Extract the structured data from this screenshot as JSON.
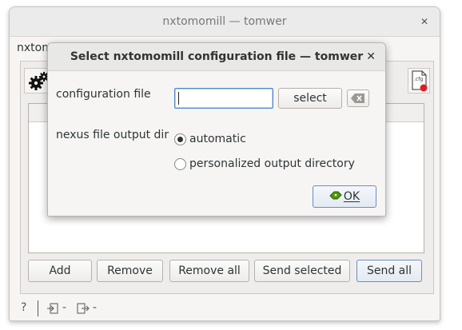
{
  "window": {
    "title": "nxtomomill — tomwer",
    "close_glyph": "✕",
    "main_label": "nxtom"
  },
  "toolbar": {
    "gear_icon": "gears-icon",
    "cfg_icon": "cfg-file-icon",
    "cfg_text": ".cfg"
  },
  "buttons": {
    "add": "Add",
    "remove": "Remove",
    "remove_all": "Remove all",
    "send_selected": "Send selected",
    "send_all": "Send all"
  },
  "statusbar": {
    "help": "?",
    "input_dash": "-",
    "output_dash": "-"
  },
  "dialog": {
    "title": "Select nxtomomill configuration file — tomwer",
    "close_glyph": "✕",
    "config_label": "configuration file",
    "config_value": "",
    "select_label": "select",
    "output_label": "nexus file output dir",
    "radio_auto": "automatic",
    "radio_personal": "personalized output directory",
    "ok_label": "OK"
  }
}
